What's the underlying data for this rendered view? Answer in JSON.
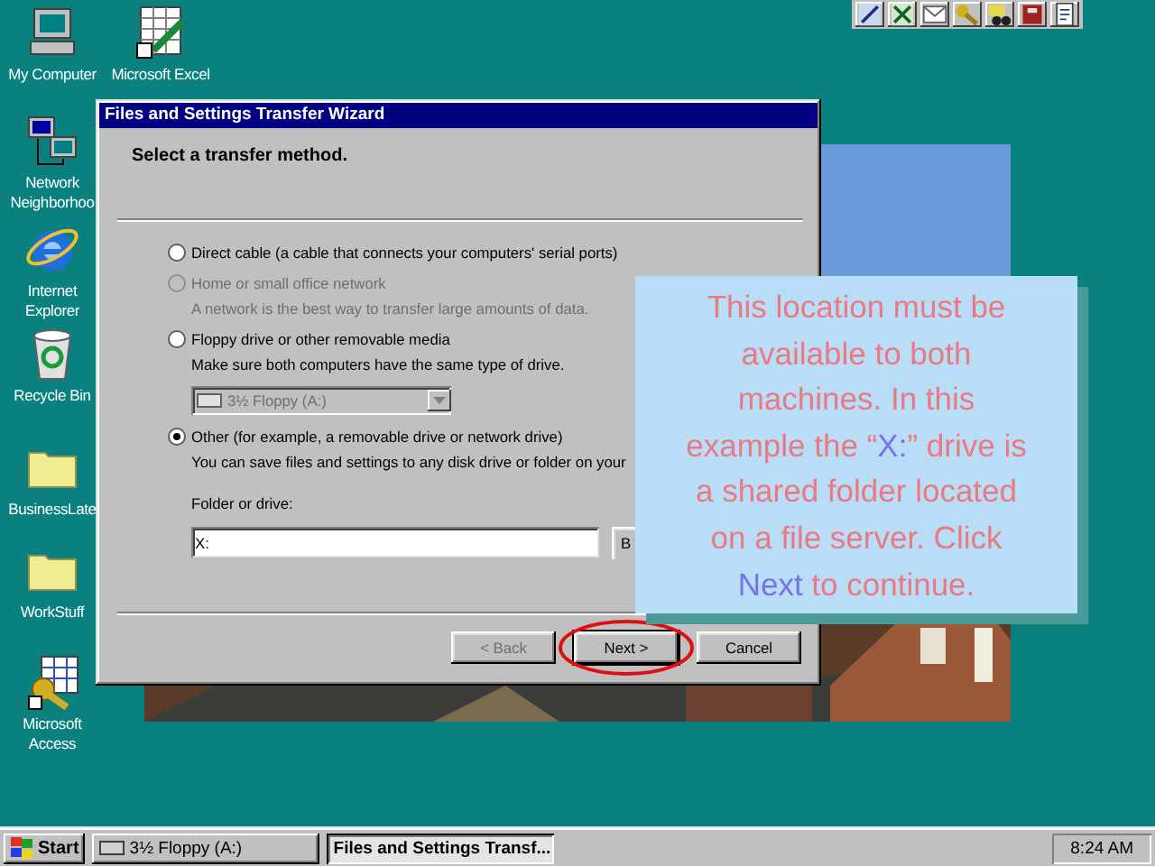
{
  "desktop_icons": [
    {
      "label": "My Computer",
      "kind": "computer"
    },
    {
      "label": "Microsoft Excel",
      "kind": "spreadsheet"
    },
    {
      "label": "Network Neighborhoo",
      "kind": "network"
    },
    {
      "label": "Internet Explorer",
      "kind": "globe"
    },
    {
      "label": "Recycle Bin",
      "kind": "recycle"
    },
    {
      "label": "BusinessLate",
      "kind": "folder"
    },
    {
      "label": "WorkStuff",
      "kind": "folder"
    },
    {
      "label": "Microsoft Access",
      "kind": "key"
    }
  ],
  "dialog": {
    "title": "Files and Settings Transfer Wizard",
    "heading": "Select a transfer method.",
    "options": [
      {
        "label": "Direct cable (a cable that connects your computers' serial ports)",
        "selected": false,
        "disabled": false
      },
      {
        "label": "Home or small office network",
        "description": "A network is the best way to transfer large amounts of data.",
        "selected": false,
        "disabled": true
      },
      {
        "label": "Floppy drive or other removable media",
        "description": "Make sure both computers have the same type of drive.",
        "selected": false,
        "disabled": false,
        "drive_select": {
          "value": "3½ Floppy (A:)",
          "disabled": true
        }
      },
      {
        "label": "Other (for example, a removable drive or network drive)",
        "description": "You can save files and settings to any disk drive or folder on your",
        "selected": true,
        "disabled": false,
        "folder_field": {
          "label": "Folder or drive:",
          "value": "X:",
          "button": "B"
        }
      }
    ],
    "buttons": [
      {
        "label": "< Back",
        "disabled": true,
        "circled": false
      },
      {
        "label": "Next >",
        "disabled": false,
        "circled": true
      },
      {
        "label": "Cancel",
        "disabled": false,
        "circled": false
      }
    ]
  },
  "callout": {
    "lines": [
      [
        {
          "text": "This location must be",
          "kind": "normal"
        }
      ],
      [
        {
          "text": "available to both",
          "kind": "normal"
        }
      ],
      [
        {
          "text": "machines. In this",
          "kind": "normal"
        }
      ],
      [
        {
          "text": "example the “",
          "kind": "normal"
        },
        {
          "text": "X:",
          "kind": "highlight"
        },
        {
          "text": "” drive is",
          "kind": "normal"
        }
      ],
      [
        {
          "text": "a shared folder located",
          "kind": "normal"
        }
      ],
      [
        {
          "text": "on a file server. Click",
          "kind": "normal"
        }
      ],
      [
        {
          "text": "Next",
          "kind": "highlight"
        },
        {
          "text": " to continue.",
          "kind": "normal"
        }
      ]
    ]
  },
  "taskbar": {
    "start": "Start",
    "tasks": [
      {
        "label": "3½ Floppy (A:)",
        "selected": false,
        "kind": "drive"
      },
      {
        "label": "Files and Settings Transf...",
        "selected": true,
        "kind": "window"
      }
    ],
    "clock": "8:24 AM"
  }
}
